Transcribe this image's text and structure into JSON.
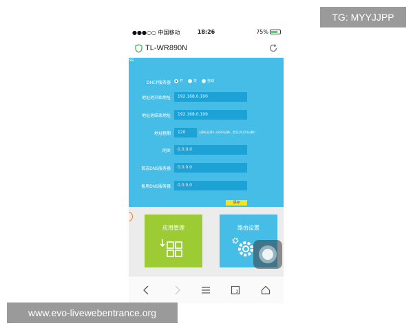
{
  "status_bar": {
    "carrier": "●●●○○ 中国移动",
    "time": "18:26",
    "battery": "75%"
  },
  "app": {
    "title": "TL-WR890N"
  },
  "corner_text": "ss",
  "form": {
    "dhcp": {
      "label": "DHCP服务器",
      "options": [
        "开",
        "关",
        "自动"
      ],
      "selected": "开"
    },
    "start_ip": {
      "label": "地址池开始地址",
      "value": "192.168.0.100"
    },
    "end_ip": {
      "label": "地址池结束地址",
      "value": "192.168.0.199"
    },
    "lease": {
      "label": "地址租期",
      "value": "120",
      "hint": "分钟(支持1-2880分钟，默认为120分钟)"
    },
    "gateway": {
      "label": "网关",
      "value": "0.0.0.0"
    },
    "dns1": {
      "label": "首选DNS服务器",
      "value": "0.0.0.0"
    },
    "dns2": {
      "label": "备用DNS服务器",
      "value": "0.0.0.0"
    },
    "save": "保存"
  },
  "tiles": [
    {
      "label": "应用管理",
      "icon": "apps-grid-icon",
      "color": "#9ccb34"
    },
    {
      "label": "路由设置",
      "icon": "gear-icon",
      "color": "#46bde6"
    }
  ],
  "overlays": {
    "top_right": "TG: MYYJJPP",
    "bottom_left": "www.evo-livewebentrance.org"
  },
  "colors": {
    "blue": "#46bde6",
    "green": "#9ccb34",
    "save": "#f5e225"
  }
}
